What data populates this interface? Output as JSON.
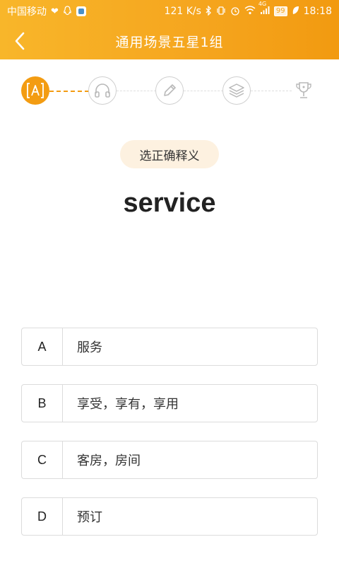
{
  "status_bar": {
    "carrier": "中国移动",
    "network_speed": "121 K/s",
    "signal_label": "4G",
    "battery": "99",
    "time": "18:18"
  },
  "nav": {
    "title": "通用场景五星1组"
  },
  "steps": [
    {
      "name": "letter-a-icon",
      "state": "active"
    },
    {
      "name": "headphones-icon",
      "state": "inactive"
    },
    {
      "name": "pencil-icon",
      "state": "inactive"
    },
    {
      "name": "layers-icon",
      "state": "inactive"
    },
    {
      "name": "trophy-icon",
      "state": "inactive"
    }
  ],
  "question": {
    "prompt": "选正确释义",
    "word": "service"
  },
  "options": [
    {
      "letter": "A",
      "text": "服务"
    },
    {
      "letter": "B",
      "text": "享受，享有，享用"
    },
    {
      "letter": "C",
      "text": "客房，房间"
    },
    {
      "letter": "D",
      "text": "预订"
    }
  ],
  "colors": {
    "accent": "#f39c12",
    "header_gradient_start": "#f8b62a",
    "header_gradient_end": "#f29a10",
    "prompt_bg": "#fdf1e0"
  }
}
